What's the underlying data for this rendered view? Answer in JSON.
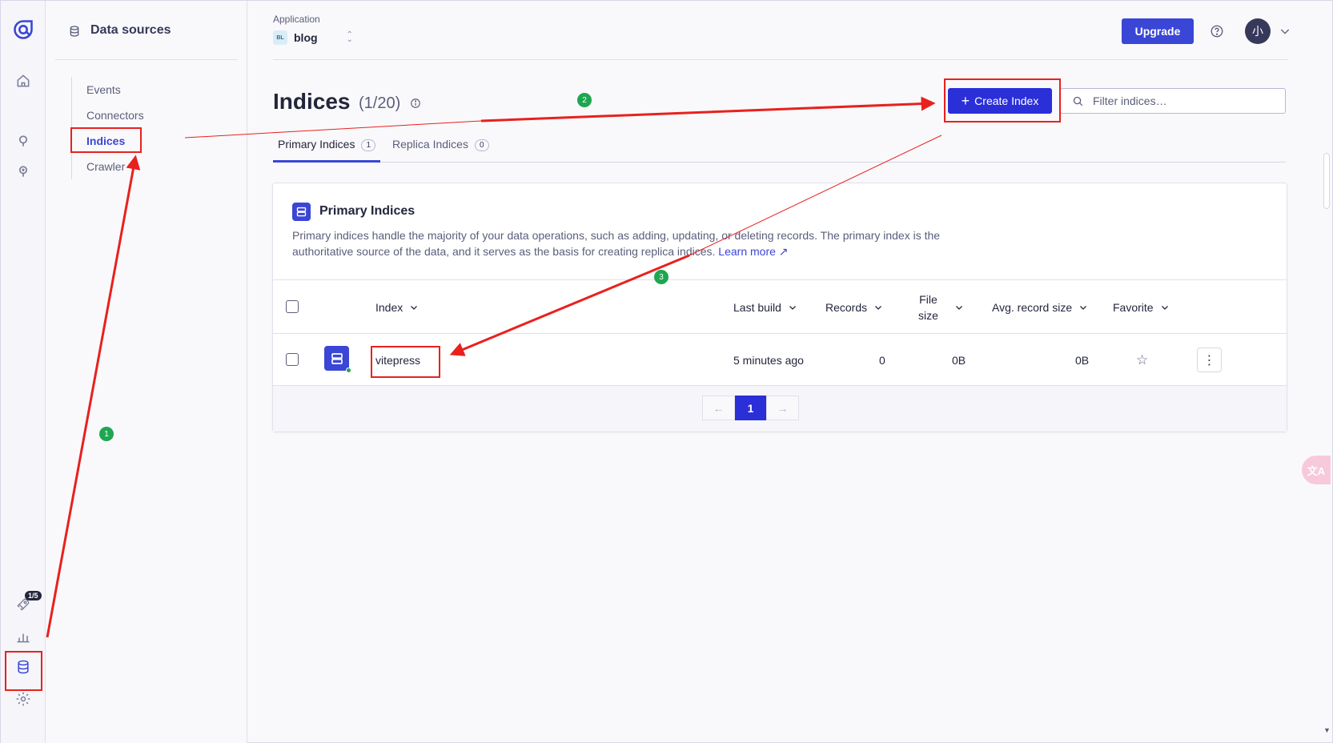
{
  "sidebar": {
    "title": "Data sources",
    "items": [
      {
        "label": "Events",
        "active": false
      },
      {
        "label": "Connectors",
        "active": false
      },
      {
        "label": "Indices",
        "active": true
      },
      {
        "label": "Crawler",
        "active": false
      }
    ]
  },
  "rail": {
    "icons": [
      "algolia-logo-icon",
      "home-icon",
      "search-bulb-icon",
      "lightbulb-icon",
      "rocket-icon",
      "analytics-icon",
      "database-icon",
      "settings-icon"
    ],
    "rocket_badge": "1/5"
  },
  "header": {
    "application_label": "Application",
    "app_tag": "BL",
    "app_name": "blog",
    "upgrade_label": "Upgrade",
    "avatar_initial": "小"
  },
  "main": {
    "title": "Indices",
    "count": "(1/20)",
    "create_label": "Create Index",
    "filter_placeholder": "Filter indices…",
    "tabs": [
      {
        "label": "Primary Indices",
        "count": "1",
        "active": true
      },
      {
        "label": "Replica Indices",
        "count": "0",
        "active": false
      }
    ]
  },
  "card": {
    "title": "Primary Indices",
    "description": "Primary indices handle the majority of your data operations, such as adding, updating, or deleting records. The primary index is the authoritative source of the data, and it serves as the basis for creating replica indices.",
    "learn_more": "Learn more"
  },
  "table": {
    "columns": {
      "index": "Index",
      "last_build": "Last build",
      "records": "Records",
      "file_size_1": "File",
      "file_size_2": "size",
      "avg_record_size": "Avg. record size",
      "favorite": "Favorite"
    },
    "rows": [
      {
        "name": "vitepress",
        "last_build": "5 minutes ago",
        "records": "0",
        "file_size": "0B",
        "avg_record_size": "0B",
        "favorite": false
      }
    ]
  },
  "pagination": {
    "prev": "←",
    "current": "1",
    "next": "→"
  },
  "annotations": {
    "step1": "1",
    "step2": "2",
    "step3": "3",
    "color": "#e8211e",
    "step_color": "#1fa651"
  },
  "colors": {
    "accent": "#3a46d6",
    "primary_button": "#2a2fd8",
    "status_ok": "#1fa651"
  },
  "widgets": {
    "translate_label": "文A"
  }
}
